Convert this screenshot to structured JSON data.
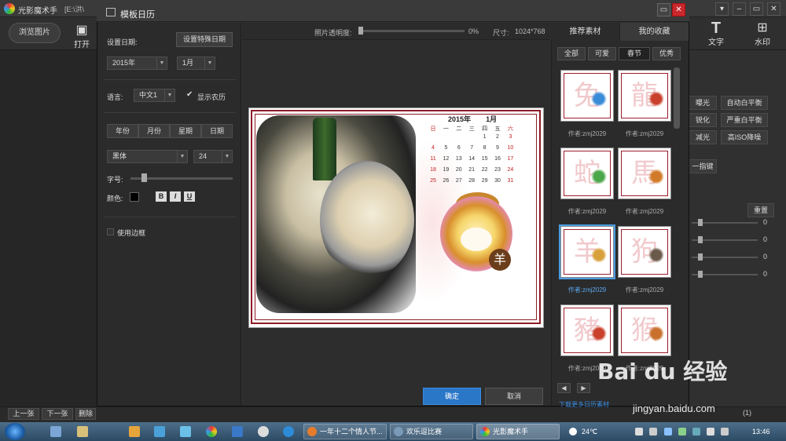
{
  "app": {
    "title": "光影魔术手",
    "path": "[E:\\洪\\",
    "browse_label": "浏览图片",
    "open_label": "打开",
    "text_label": "文字",
    "watermark_label": "水印",
    "right_buttons": [
      "曝光",
      "自动白平衡",
      "锐化",
      "严重白平衡",
      "减光",
      "高ISO降噪"
    ],
    "one_key": "一指键",
    "reset_label": "重置",
    "slider_values": [
      "0",
      "0",
      "0",
      "0"
    ],
    "bottom": {
      "prev": "上一张",
      "next": "下一张",
      "delete": "删除",
      "count": "(1)"
    }
  },
  "dialog": {
    "title": "模板日历",
    "controls": {
      "minimize": "▭",
      "close": "✕"
    },
    "left": {
      "date_label": "设置日期:",
      "special_date_button": "设置特殊日期",
      "year": "2015年",
      "month": "1月",
      "language_label": "语言:",
      "language": "中文1",
      "show_lunar_checked": "✔",
      "show_lunar_label": "显示农历",
      "segments": [
        "年份",
        "月份",
        "星期",
        "日期"
      ],
      "font": "黑体",
      "font_size": "24",
      "size_label": "字号:",
      "color_label": "颜色:",
      "bold": "B",
      "italic": "I",
      "underline": "U",
      "use_border_label": "使用边框"
    },
    "center": {
      "opacity_label": "照片透明度:",
      "opacity_value": "0%",
      "opacity_fraction": 0,
      "size_label": "尺寸:",
      "size_value": "1024*768",
      "calendar_year": "2015年",
      "calendar_month": "1月",
      "weekdays": [
        "日",
        "一",
        "二",
        "三",
        "四",
        "五",
        "六"
      ],
      "days": [
        "1",
        "2",
        "3",
        "4",
        "5",
        "6",
        "7",
        "8",
        "9",
        "10",
        "11",
        "12",
        "13",
        "14",
        "15",
        "16",
        "17",
        "18",
        "19",
        "20",
        "21",
        "22",
        "23",
        "24",
        "25",
        "26",
        "27",
        "28",
        "29",
        "30",
        "31"
      ],
      "first_weekday_index": 4,
      "zodiac_char": "羊",
      "ok": "确定",
      "cancel": "取消"
    },
    "right": {
      "tabs": [
        "推荐素材",
        "我的收藏"
      ],
      "categories": [
        "全部",
        "可爱",
        "春节",
        "优秀"
      ],
      "templates": [
        {
          "char": "兔",
          "author": "作者:zmj2029",
          "color": "#3a8bd8"
        },
        {
          "char": "龍",
          "author": "作者:zmj2029",
          "color": "#c9402c"
        },
        {
          "char": "蛇",
          "author": "作者:zmj2029",
          "color": "#4aa74a"
        },
        {
          "char": "馬",
          "author": "作者:zmj2029",
          "color": "#d17b2a"
        },
        {
          "char": "羊",
          "author": "作者:zmj2029",
          "color": "#d8a03a"
        },
        {
          "char": "狗",
          "author": "作者:zmj2029",
          "color": "#6a5a4a"
        },
        {
          "char": "豬",
          "author": "作者:zmj2029",
          "color": "#c9402c"
        },
        {
          "char": "猴",
          "author": "作者:zmj2029",
          "color": "#c9702c"
        }
      ],
      "nav_prev": "◀",
      "nav_next": "▶",
      "more_link": "下载更多日历素材"
    }
  },
  "taskbar": {
    "tasks": [
      "一年十二个情人节...",
      "欢乐逗比赛",
      "光影魔术手"
    ],
    "temperature": "24℃",
    "time": "13:46"
  },
  "watermark": {
    "brand": "Bai du 经验",
    "url": "jingyan.baidu.com"
  }
}
